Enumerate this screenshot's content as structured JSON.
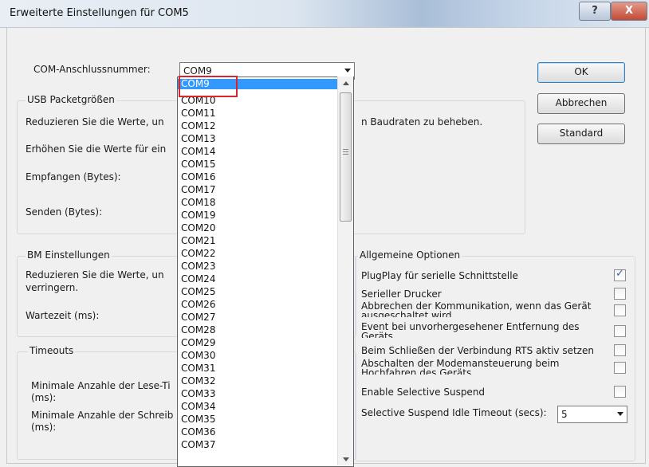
{
  "window": {
    "title": "Erweiterte Einstellungen für COM5",
    "help_label": "?",
    "close_label": "X"
  },
  "port": {
    "label": "COM-Anschlussnummer:",
    "value": "COM9"
  },
  "buttons": {
    "ok": "OK",
    "cancel": "Abbrechen",
    "default": "Standard"
  },
  "usb": {
    "title": "USB Packetgrößen",
    "line1_left": "Reduzieren Sie die Werte, un",
    "line1_right": "n Baudraten zu beheben.",
    "line2_left": "Erhöhen Sie die Werte für ein",
    "receive_label": "Empfangen (Bytes):",
    "send_label": "Senden (Bytes):"
  },
  "bm": {
    "title": "BM Einstellungen",
    "desc_line1": "Reduzieren Sie die Werte, un",
    "desc_line2": "verringern.",
    "latency_label": "Wartezeit (ms):"
  },
  "timeouts": {
    "title": "Timeouts",
    "read_line1": "Minimale Anzahle der Lese-Ti",
    "read_line2": "(ms):",
    "write_line1": "Minimale Anzahle der Schreib",
    "write_line2": "(ms):"
  },
  "general": {
    "title": "Allgemeine Optionen",
    "options": [
      {
        "label": "PlugPlay für serielle Schnittstelle",
        "checked": true
      },
      {
        "label": "Serieller Drucker",
        "checked": false
      },
      {
        "label": "Abbrechen der Kommunikation, wenn das Gerät ausgeschaltet wird",
        "checked": false
      },
      {
        "label": "Event bei unvorhergesehener Entfernung des Geräts",
        "checked": false
      },
      {
        "label": "Beim Schließen der Verbindung RTS aktiv setzen",
        "checked": false
      },
      {
        "label": "Abschalten der Modemansteuerung beim Hochfahren des Geräts",
        "checked": false
      },
      {
        "label": "Enable Selective Suspend",
        "checked": false
      }
    ],
    "idle_label": "Selective Suspend Idle Timeout (secs):",
    "idle_value": "5"
  },
  "dropdown": {
    "selected": "COM9",
    "items": [
      "COM9",
      "COM10",
      "COM11",
      "COM12",
      "COM13",
      "COM14",
      "COM15",
      "COM16",
      "COM17",
      "COM18",
      "COM19",
      "COM20",
      "COM21",
      "COM22",
      "COM23",
      "COM24",
      "COM25",
      "COM26",
      "COM27",
      "COM28",
      "COM29",
      "COM30",
      "COM31",
      "COM32",
      "COM33",
      "COM34",
      "COM35",
      "COM36",
      "COM37"
    ]
  },
  "colors": {
    "selection": "#3399ff",
    "highlight_box": "#d9262c"
  }
}
